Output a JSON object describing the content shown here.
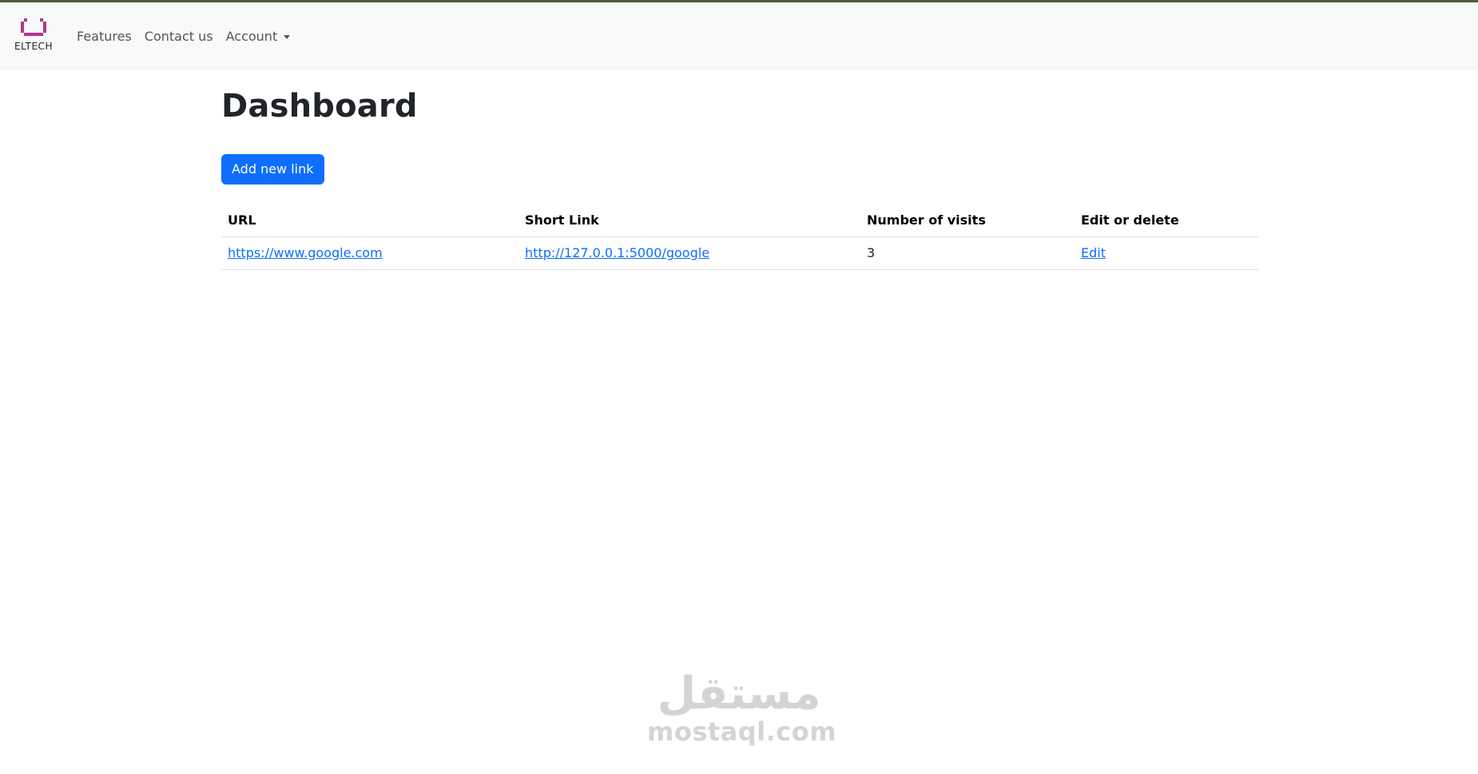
{
  "brand": {
    "logo_text": "ELTECH",
    "accent_color": "#b8338a",
    "icon": "eltech-logo-icon"
  },
  "nav": {
    "items": [
      {
        "label": "Features"
      },
      {
        "label": "Contact us"
      },
      {
        "label": "Account",
        "dropdown": true
      }
    ]
  },
  "page": {
    "title": "Dashboard"
  },
  "actions": {
    "add_link_label": "Add new link",
    "primary_color": "#0d6efd"
  },
  "table": {
    "headers": [
      "URL",
      "Short Link",
      "Number of visits",
      "Edit or delete"
    ],
    "rows": [
      {
        "url": "https://www.google.com",
        "short_link": "http://127.0.0.1:5000/google",
        "visits": "3",
        "action": "Edit"
      }
    ]
  },
  "watermark": {
    "arabic": "مستقل",
    "latin": "mostaql.com"
  }
}
